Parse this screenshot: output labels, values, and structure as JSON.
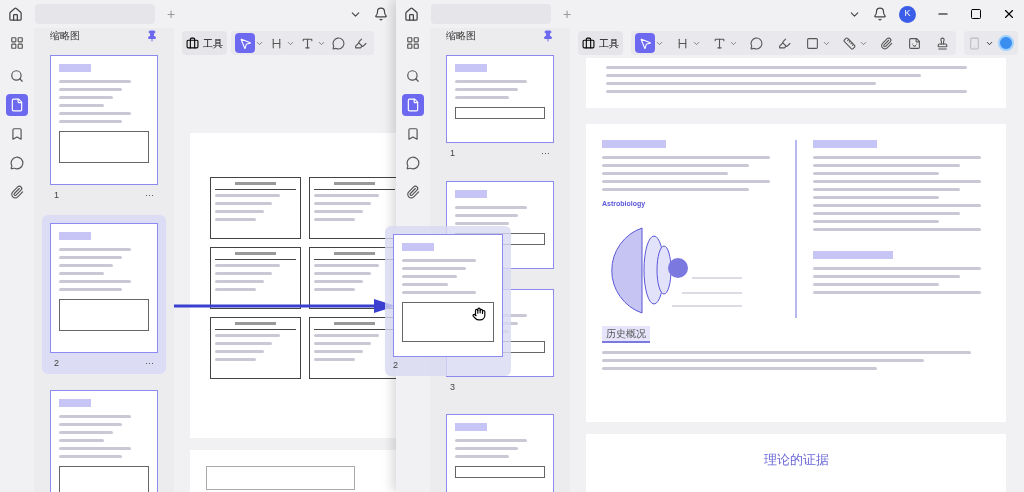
{
  "windows": [
    {
      "tab_add": "+",
      "sidebar_title": "缩略图",
      "toolbar_label": "工具",
      "sidebar_icons": [
        {
          "kind": "search",
          "selected": false
        },
        {
          "kind": "page",
          "selected": true
        },
        {
          "kind": "bookmark",
          "selected": false
        },
        {
          "kind": "comment",
          "selected": false
        },
        {
          "kind": "attach",
          "selected": false
        }
      ],
      "tools": [
        {
          "kind": "select",
          "selected": true,
          "menu": true
        },
        {
          "kind": "heading",
          "selected": false,
          "menu": true
        },
        {
          "kind": "text",
          "selected": false,
          "menu": true
        },
        {
          "kind": "comment",
          "selected": false,
          "menu": false
        },
        {
          "kind": "highlight",
          "selected": false,
          "menu": false
        }
      ],
      "thumbnails": [
        {
          "number": "1",
          "more": "···",
          "selected": false
        },
        {
          "number": "2",
          "more": "···",
          "selected": true
        },
        {
          "selected": false
        }
      ],
      "pages": [
        {
          "kind": "table"
        },
        {
          "kind": "blank"
        }
      ]
    },
    {
      "tab_add": "+",
      "avatar": "K",
      "sidebar_title": "缩略图",
      "toolbar_label": "工具",
      "sidebar_icons": [
        {
          "kind": "search",
          "selected": false
        },
        {
          "kind": "page",
          "selected": true
        },
        {
          "kind": "bookmark",
          "selected": false
        },
        {
          "kind": "comment",
          "selected": false
        },
        {
          "kind": "attach",
          "selected": false
        }
      ],
      "tools": [
        {
          "kind": "select",
          "selected": true,
          "menu": true
        },
        {
          "kind": "heading",
          "selected": false,
          "menu": true
        },
        {
          "kind": "text",
          "selected": false,
          "menu": true
        },
        {
          "kind": "comment",
          "selected": false,
          "menu": false
        },
        {
          "kind": "highlight",
          "selected": false,
          "menu": false
        },
        {
          "kind": "shape",
          "selected": false,
          "menu": true
        },
        {
          "kind": "measure",
          "selected": false,
          "menu": true
        },
        {
          "kind": "attach",
          "selected": false,
          "menu": false
        },
        {
          "kind": "sticker",
          "selected": false,
          "menu": false
        },
        {
          "kind": "stamp",
          "selected": false,
          "menu": false
        }
      ],
      "thumbnails": [
        {
          "number": "1",
          "more": "···",
          "selected": false
        },
        {
          "selected": false
        },
        {
          "number": "3",
          "selected": false
        },
        {
          "selected": false
        }
      ],
      "pages": [
        {
          "kind": "strip"
        },
        {
          "kind": "article",
          "heading": "Astrobiology",
          "section": "历史概况"
        },
        {
          "kind": "title",
          "heading": "理论的证据"
        }
      ]
    }
  ],
  "drag": {
    "number": "2"
  }
}
